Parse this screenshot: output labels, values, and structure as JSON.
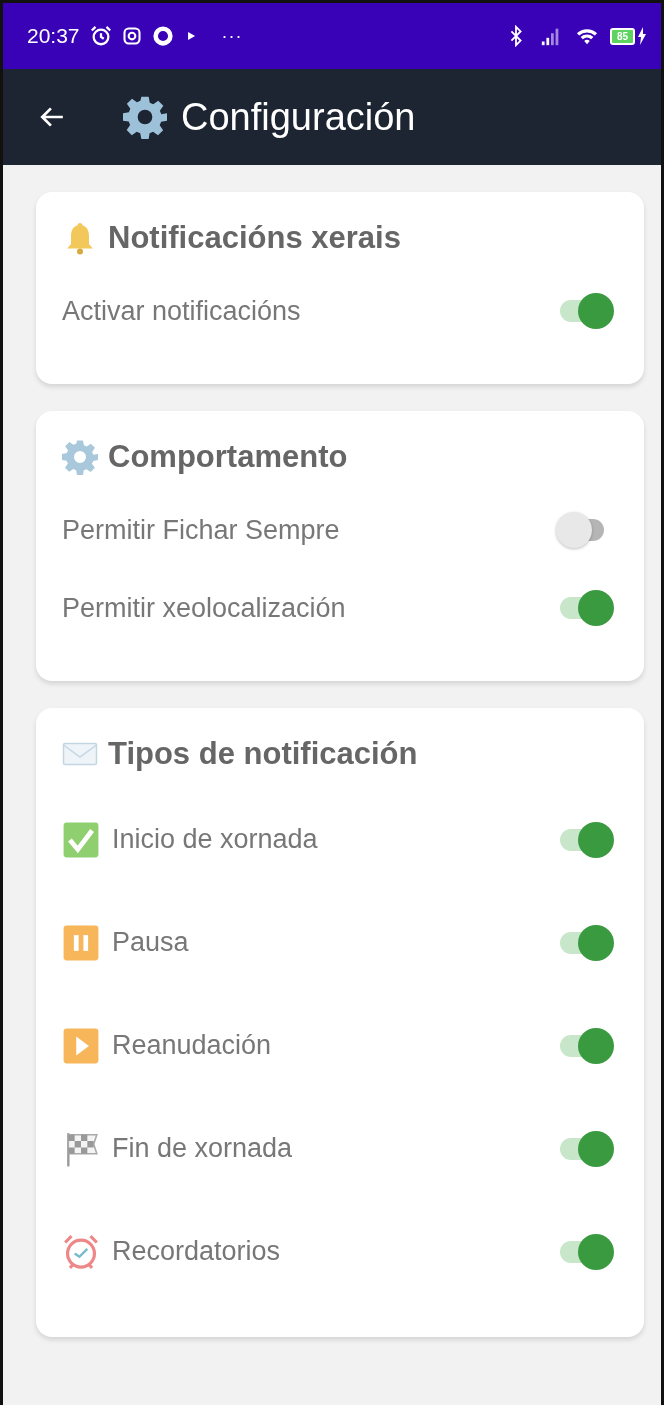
{
  "status_bar": {
    "time": "20:37",
    "more": "···",
    "battery": "85"
  },
  "header": {
    "title": "Configuración"
  },
  "sections": [
    {
      "title": "Notificacións xerais",
      "kind": "bell",
      "items": [
        {
          "label": "Activar notificacións",
          "on": true
        }
      ]
    },
    {
      "title": "Comportamento",
      "kind": "gear",
      "items": [
        {
          "label": "Permitir Fichar Sempre",
          "on": false
        },
        {
          "label": "Permitir xeolocalización",
          "on": true
        }
      ]
    },
    {
      "title": "Tipos de notificación",
      "kind": "envelope",
      "items": [
        {
          "label": "Inicio de xornada",
          "on": true,
          "kind": "check"
        },
        {
          "label": "Pausa",
          "on": true,
          "kind": "pause"
        },
        {
          "label": "Reanudación",
          "on": true,
          "kind": "play"
        },
        {
          "label": "Fin de xornada",
          "on": true,
          "kind": "flag"
        },
        {
          "label": "Recordatorios",
          "on": true,
          "kind": "alarm"
        }
      ]
    }
  ]
}
